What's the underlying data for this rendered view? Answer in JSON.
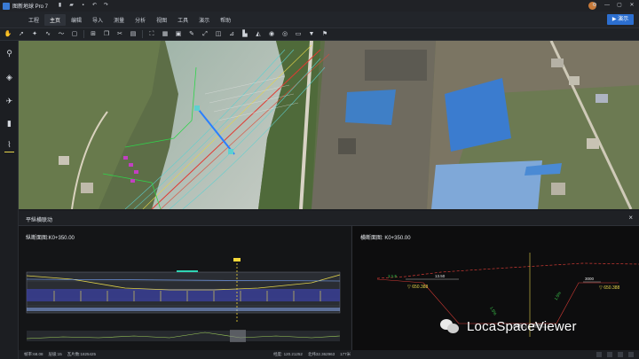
{
  "app": {
    "title": "图新地球 Pro 7"
  },
  "menu": {
    "items": [
      "工程",
      "主页",
      "编辑",
      "导入",
      "测量",
      "分析",
      "视图",
      "工具",
      "演示",
      "帮助"
    ],
    "active_index": 1
  },
  "display_button": {
    "label": "▶ 演示"
  },
  "panel": {
    "title": "平纵横联动",
    "close_label": "×",
    "profile": {
      "label": "纵断面图:K0+350.00"
    },
    "cross": {
      "label": "横断面图: K0+350.00",
      "annotations": [
        "▽ 650.388",
        "▽ 650.388",
        "13.50",
        "3000",
        "3000",
        "3000",
        "1.5%",
        "1.5%",
        "1:1.5"
      ]
    }
  },
  "status": {
    "items": [
      "帧率:68.08",
      "层级:15",
      "瓦片数:1825425",
      "经度: 120.21252",
      "北纬32.362963",
      "177米"
    ]
  },
  "watermark": {
    "text": "LocaSpaceViewer"
  },
  "colors": {
    "accent": "#2c6fd0",
    "profile_line": "#e6d44a",
    "cross_line": "#d33b35"
  }
}
